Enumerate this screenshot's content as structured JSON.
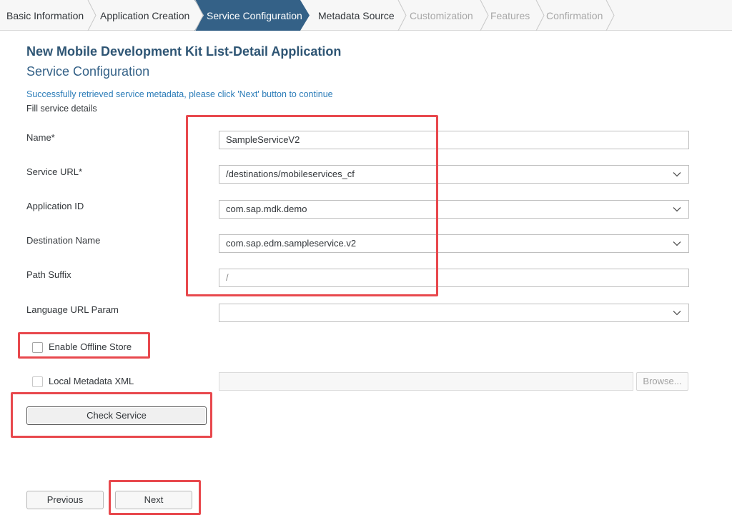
{
  "wizard": {
    "steps": [
      {
        "label": "Basic Information",
        "state": "done"
      },
      {
        "label": "Application Creation",
        "state": "done"
      },
      {
        "label": "Service Configuration",
        "state": "active"
      },
      {
        "label": "Metadata Source",
        "state": "next"
      },
      {
        "label": "Customization",
        "state": "disabled"
      },
      {
        "label": "Features",
        "state": "disabled"
      },
      {
        "label": "Confirmation",
        "state": "disabled"
      }
    ],
    "colors": {
      "active": "#346187",
      "done": "#f7f7f7",
      "disabled_text": "#a8a8a8"
    }
  },
  "page": {
    "title": "New Mobile Development Kit List-Detail Application",
    "subtitle": "Service Configuration",
    "success_message": "Successfully retrieved service metadata, please click 'Next' button to continue",
    "instructions": "Fill service details"
  },
  "form": {
    "name": {
      "label": "Name*",
      "value": "SampleServiceV2"
    },
    "service_url": {
      "label": "Service URL*",
      "value": "/destinations/mobileservices_cf",
      "icon": "chevron-down-icon"
    },
    "application_id": {
      "label": "Application ID",
      "value": "com.sap.mdk.demo",
      "icon": "chevron-down-icon"
    },
    "destination_name": {
      "label": "Destination Name",
      "value": "com.sap.edm.sampleservice.v2",
      "icon": "chevron-down-icon"
    },
    "path_suffix": {
      "label": "Path Suffix",
      "placeholder": "/"
    },
    "language_url_param": {
      "label": "Language URL Param",
      "value": "",
      "icon": "chevron-down-icon"
    },
    "enable_offline_store": {
      "label": "Enable Offline Store",
      "checked": false
    },
    "local_metadata_xml": {
      "label": "Local Metadata XML",
      "checked": false,
      "enabled": false,
      "value": ""
    },
    "browse_label": "Browse..."
  },
  "buttons": {
    "check_service": "Check Service",
    "previous": "Previous",
    "next": "Next"
  },
  "annotation_color": "#e8484d"
}
